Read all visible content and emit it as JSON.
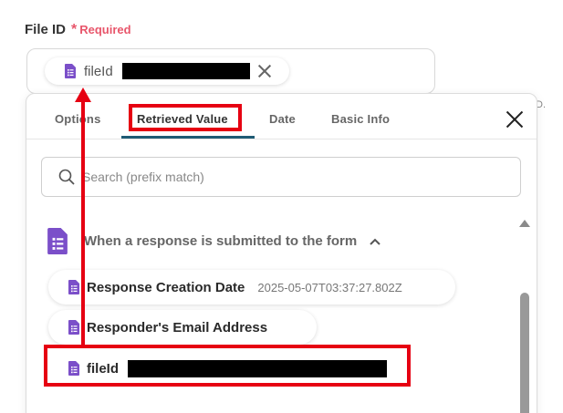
{
  "field": {
    "title": "File ID",
    "required_star": "*",
    "required_text": "Required",
    "chip_label": "fileId",
    "hint_suffix": "D."
  },
  "panel": {
    "tabs": [
      {
        "label": "Options"
      },
      {
        "label": "Retrieved Value"
      },
      {
        "label": "Date"
      },
      {
        "label": "Basic Info"
      }
    ],
    "active_tab": "Retrieved Value",
    "search": {
      "placeholder": "Search (prefix match)",
      "value": ""
    },
    "group": {
      "label": "When a response is submitted to the form"
    },
    "items": [
      {
        "name": "Response Creation Date",
        "value": "2025-05-07T03:37:27.802Z"
      },
      {
        "name": "Responder's Email Address",
        "value": ""
      },
      {
        "name": "fileId",
        "value": ""
      }
    ]
  },
  "colors": {
    "accent_underline": "#1f5b74",
    "required": "#e8566b",
    "highlight": "#e60012",
    "form_icon": "#7b4fc9"
  },
  "icons": [
    "google-forms-icon",
    "close-icon",
    "search-icon",
    "chevron-up-icon",
    "scroll-up-icon"
  ]
}
